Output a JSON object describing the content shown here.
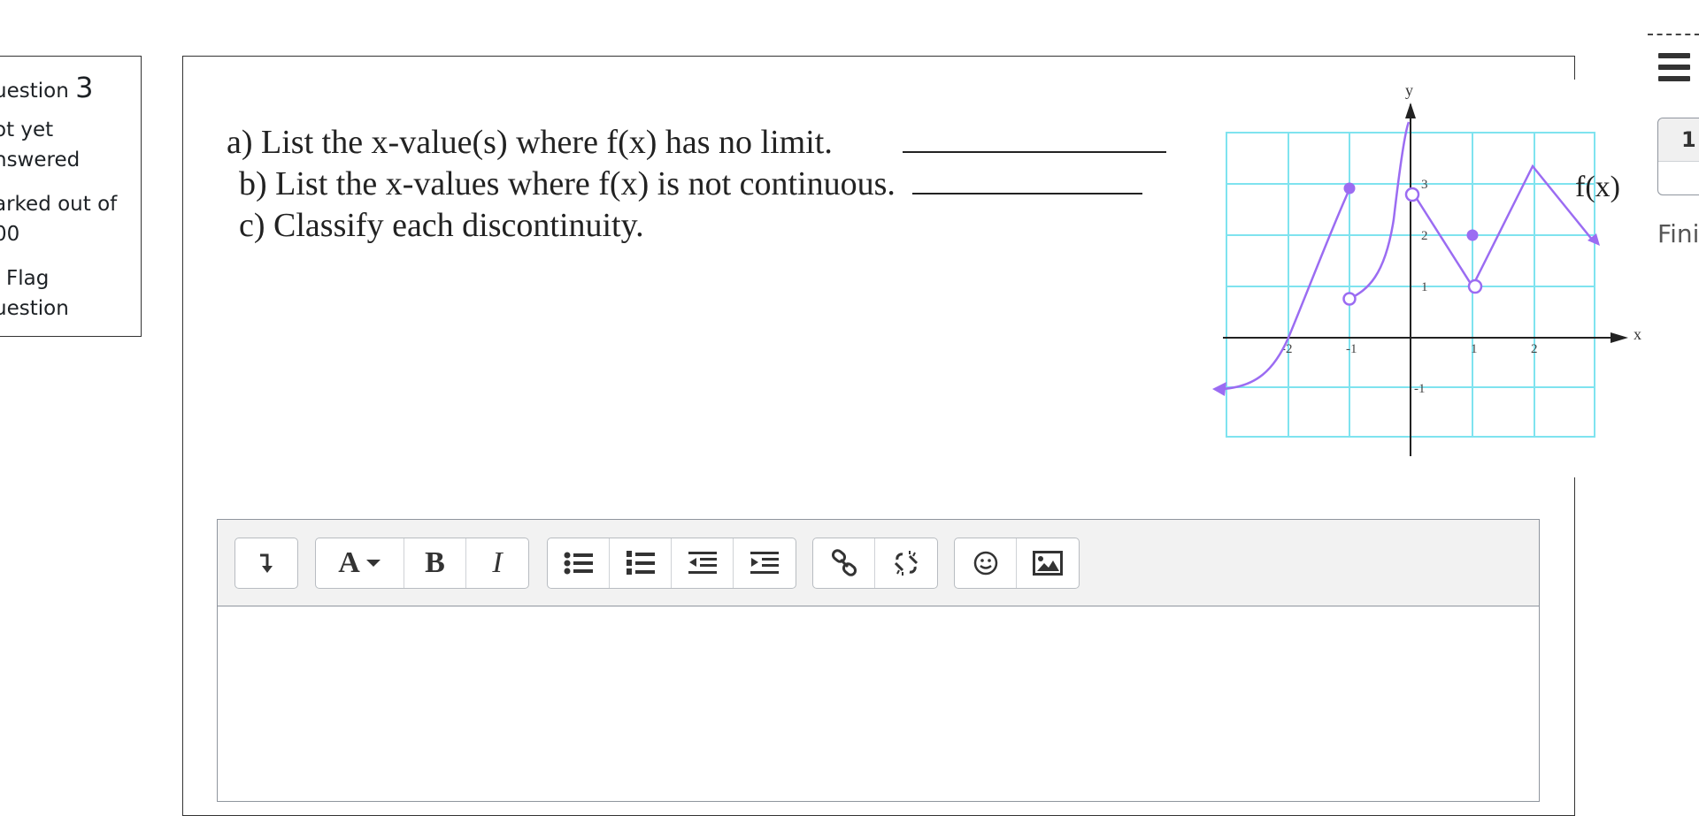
{
  "info": {
    "question_label": "uestion",
    "question_number": "3",
    "status_line1": "ot yet",
    "status_line2": "nswered",
    "marks_line1": "arked out of",
    "marks_line2": "00",
    "flag_line1": "Flag",
    "flag_line2": "uestion"
  },
  "question": {
    "line_a": "a) List the x-value(s) where f(x) has no limit.",
    "line_b": "b) List the x-values where f(x) is not continuous.",
    "line_c": "c) Classify each discontinuity."
  },
  "graph": {
    "axis_x_label": "x",
    "axis_y_label": "y",
    "function_label": "f(x)",
    "x_ticks": [
      "-2",
      "-1",
      "1",
      "2"
    ],
    "y_ticks": [
      "-1",
      "1",
      "2",
      "3"
    ],
    "grid_color": "#7fe3ef",
    "curve_color": "#9b6cf2"
  },
  "editor": {
    "toolbar": {
      "expand_icon": "arrow-down-turn-icon",
      "font_label": "A",
      "bold_label": "B",
      "italic_label": "I"
    }
  },
  "nav": {
    "page_number": "1",
    "finish_label": "Fini"
  },
  "colors": {
    "border": "#333333",
    "toolbar_bg": "#f2f2f2"
  }
}
